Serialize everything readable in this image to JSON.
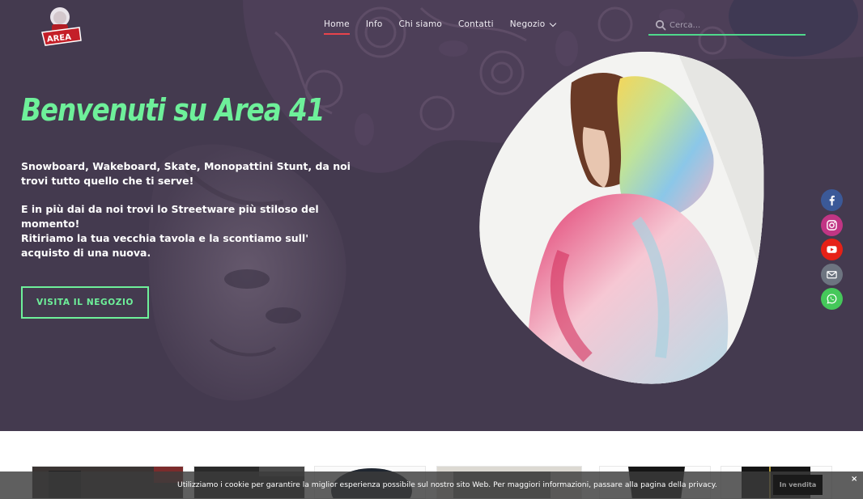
{
  "brand": {
    "logo_icon": "area41-logo-icon"
  },
  "nav": {
    "items": [
      {
        "label": "Home",
        "active": true
      },
      {
        "label": "Info",
        "active": false
      },
      {
        "label": "Chi siamo",
        "active": false
      },
      {
        "label": "Contatti",
        "active": false
      },
      {
        "label": "Negozio",
        "active": false,
        "has_dropdown": true
      }
    ]
  },
  "search": {
    "placeholder": "Cerca...",
    "icon": "search-icon"
  },
  "hero": {
    "title": "Benvenuti su Area 41",
    "paragraphs": [
      "Snowboard, Wakeboard, Skate, Monopattini Stunt, da noi trovi tutto quello che ti serve!",
      "E in più dai da noi trovi lo Streetware più stiloso del momento!",
      "Ritiriamo la tua vecchia tavola e la scontiamo sull' acquisto di una nuova."
    ],
    "cta_label": "VISITA IL NEGOZIO"
  },
  "social": [
    {
      "name": "facebook-icon",
      "color": "#3b5998"
    },
    {
      "name": "instagram-icon",
      "color": "#c13584"
    },
    {
      "name": "youtube-icon",
      "color": "#e62117"
    },
    {
      "name": "email-icon",
      "color": "#6d7480"
    },
    {
      "name": "whatsapp-icon",
      "color": "#45c85a"
    }
  ],
  "products": {
    "sale_badge": "In vendita"
  },
  "cookie": {
    "text": "Utilizziamo i cookie per garantire la miglior esperienza possibile sul nostro sito Web. Per maggiori informazioni, passare alla pagina della privacy.",
    "close_label": "×"
  },
  "colors": {
    "hero_bg": "#443a4f",
    "accent_green": "#6ef09a",
    "nav_underline": "#e8434c",
    "search_line": "#4fd98c"
  }
}
